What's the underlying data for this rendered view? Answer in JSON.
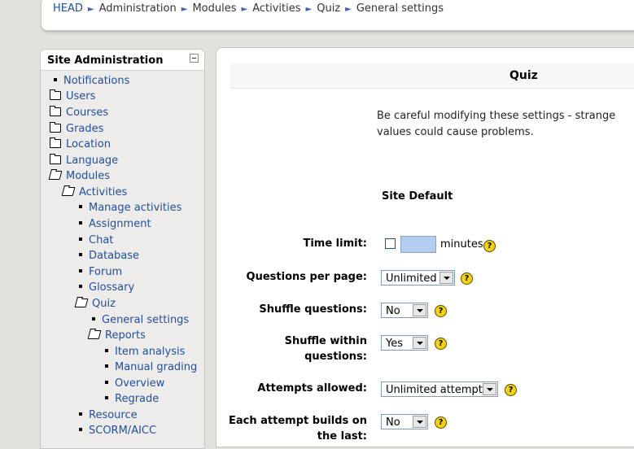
{
  "breadcrumb": {
    "items": [
      "HEAD",
      "Administration",
      "Modules",
      "Activities",
      "Quiz",
      "General settings"
    ],
    "separator": "►"
  },
  "sidebar": {
    "title": "Site Administration",
    "items": [
      {
        "label": "Notifications",
        "icon": "bullet"
      },
      {
        "label": "Users",
        "icon": "folder-closed"
      },
      {
        "label": "Courses",
        "icon": "folder-closed"
      },
      {
        "label": "Grades",
        "icon": "folder-closed"
      },
      {
        "label": "Location",
        "icon": "folder-closed"
      },
      {
        "label": "Language",
        "icon": "folder-closed"
      },
      {
        "label": "Modules",
        "icon": "folder-open"
      },
      {
        "label": "Activities",
        "icon": "folder-open"
      },
      {
        "label": "Manage activities",
        "icon": "bullet"
      },
      {
        "label": "Assignment",
        "icon": "bullet"
      },
      {
        "label": "Chat",
        "icon": "bullet"
      },
      {
        "label": "Database",
        "icon": "bullet"
      },
      {
        "label": "Forum",
        "icon": "bullet"
      },
      {
        "label": "Glossary",
        "icon": "bullet"
      },
      {
        "label": "Quiz",
        "icon": "folder-open"
      },
      {
        "label": "General settings",
        "icon": "bullet"
      },
      {
        "label": "Reports",
        "icon": "folder-open"
      },
      {
        "label": "Item analysis",
        "icon": "bullet"
      },
      {
        "label": "Manual grading",
        "icon": "bullet"
      },
      {
        "label": "Overview",
        "icon": "bullet"
      },
      {
        "label": "Regrade",
        "icon": "bullet"
      },
      {
        "label": "Resource",
        "icon": "bullet"
      },
      {
        "label": "SCORM/AICC",
        "icon": "bullet"
      }
    ]
  },
  "main": {
    "heading": "Quiz",
    "warning": "Be careful modifying these settings - strange values could cause problems.",
    "site_default": "Site Default",
    "fields": {
      "time_limit": {
        "label": "Time limit:",
        "value": "",
        "unit": "minutes",
        "checked": false
      },
      "questions_per_page": {
        "label": "Questions per page:",
        "value": "Unlimited"
      },
      "shuffle_questions": {
        "label": "Shuffle questions:",
        "value": "No"
      },
      "shuffle_within": {
        "label": "Shuffle within questions:",
        "value": "Yes"
      },
      "attempts_allowed": {
        "label": "Attempts allowed:",
        "value": "Unlimited attempts"
      },
      "each_attempt": {
        "label": "Each attempt builds on the last:",
        "value": "No"
      }
    },
    "help_glyph": "?"
  },
  "colors": {
    "link": "#1f4f9c",
    "background": "#e3e1dc",
    "help_icon": "#f4d20b",
    "input_fill": "#b5cdee"
  }
}
